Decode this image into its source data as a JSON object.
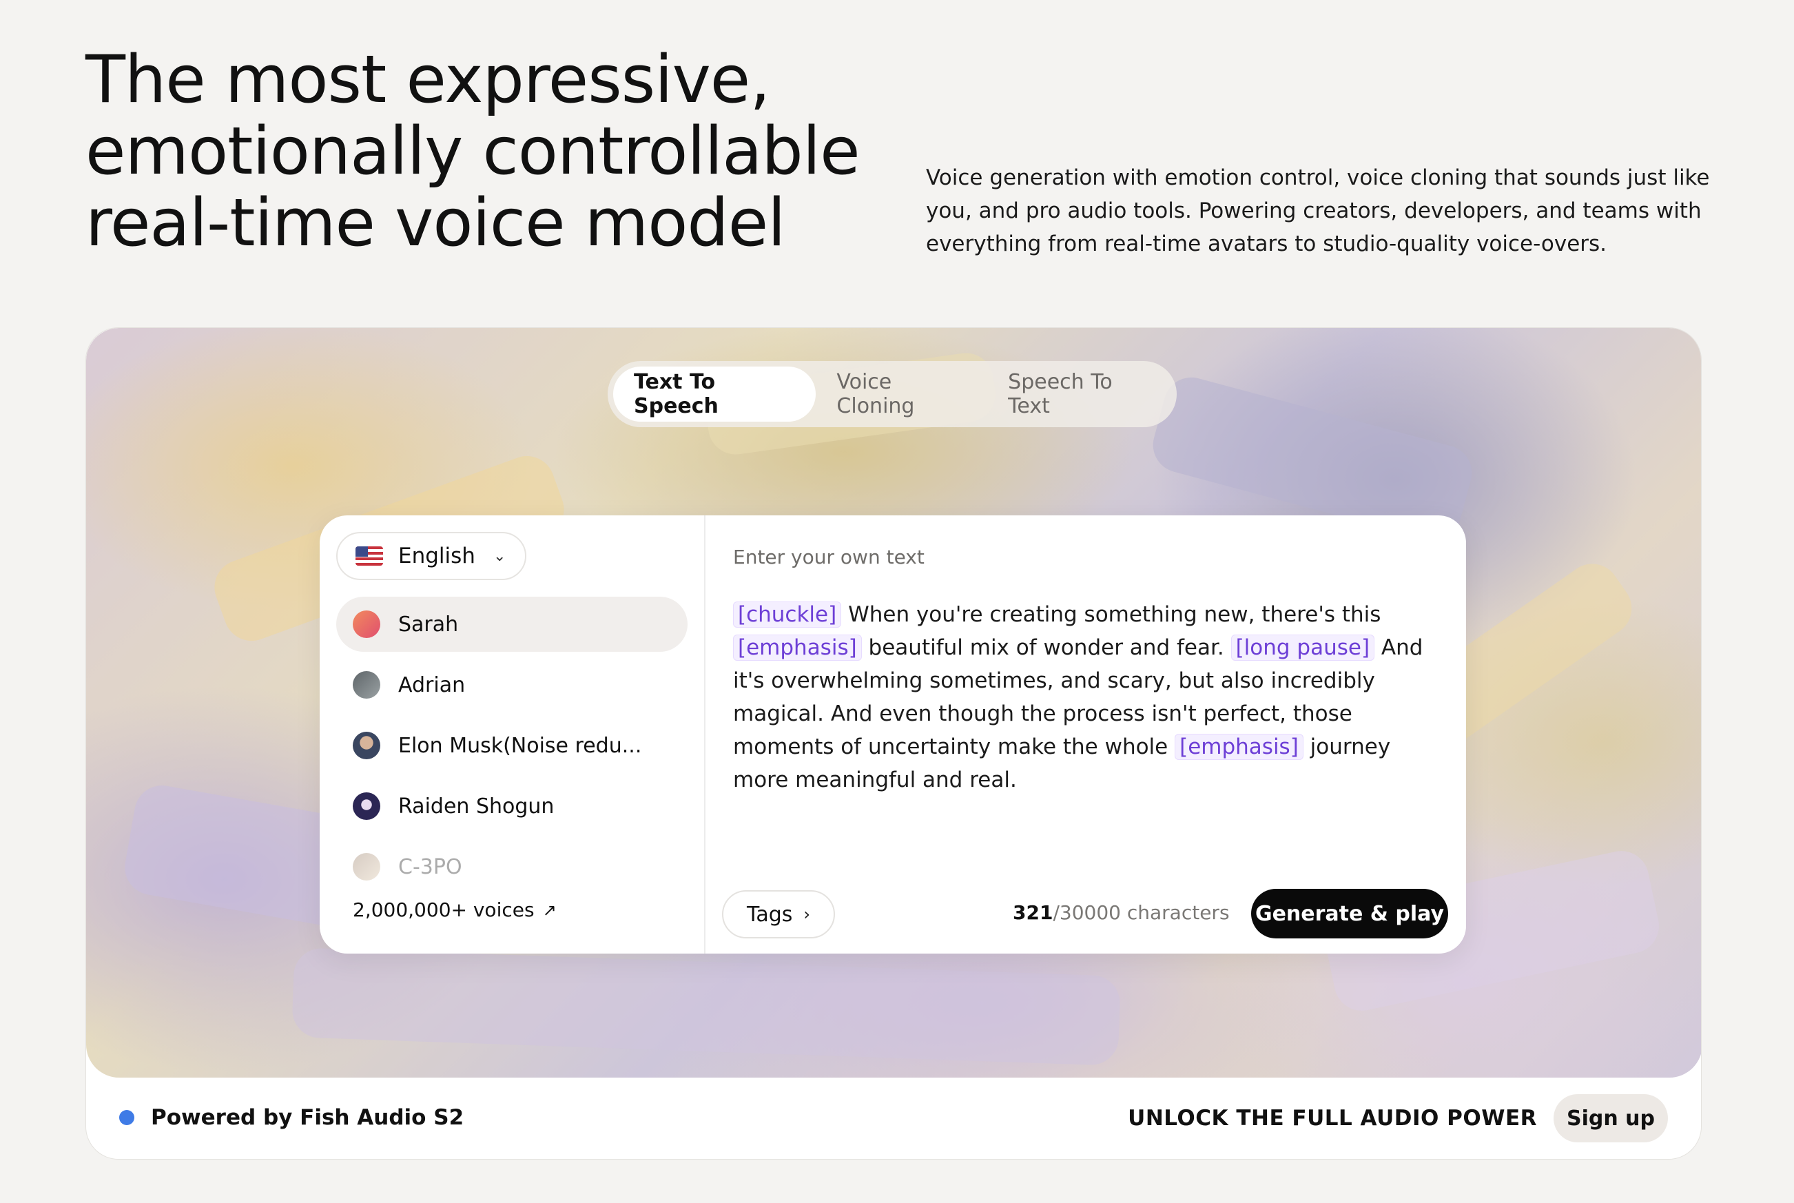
{
  "hero": {
    "title_line1": "The most expressive,",
    "title_line2": "emotionally controllable",
    "title_line3": "real-time voice model",
    "description": "Voice generation with emotion control, voice cloning that sounds just like you, and pro audio tools. Powering creators, developers, and teams with everything from real-time avatars to studio-quality voice-overs."
  },
  "tabs": [
    {
      "label": "Text To Speech",
      "active": true
    },
    {
      "label": "Voice Cloning",
      "active": false
    },
    {
      "label": "Speech To Text",
      "active": false
    }
  ],
  "language": {
    "selected": "English",
    "icon": "us-flag-icon"
  },
  "voices": [
    {
      "name": "Sarah",
      "selected": true,
      "color": "#e8685a"
    },
    {
      "name": "Adrian",
      "selected": false,
      "color": "#6b7278"
    },
    {
      "name": "Elon Musk(Noise redu...",
      "selected": false,
      "color": "#5a6a8a"
    },
    {
      "name": "Raiden Shogun",
      "selected": false,
      "color": "#3e3a6a"
    },
    {
      "name": "C-3PO",
      "selected": false,
      "color": "#b89a80"
    }
  ],
  "voices_count": "2,000,000+ voices",
  "editor": {
    "placeholder": "Enter your own text",
    "segments": [
      {
        "type": "tag",
        "text": "[chuckle]"
      },
      {
        "type": "text",
        "text": " When you're creating something new, there's this "
      },
      {
        "type": "tag",
        "text": "[emphasis]"
      },
      {
        "type": "text",
        "text": " beautiful mix of wonder and fear. "
      },
      {
        "type": "tag",
        "text": "[long pause]"
      },
      {
        "type": "text",
        "text": " And it's overwhelming sometimes, and scary, but also incredibly magical. And even though the process isn't perfect, those moments of uncertainty make the whole "
      },
      {
        "type": "tag",
        "text": "[emphasis]"
      },
      {
        "type": "text",
        "text": " journey more meaningful and real."
      }
    ]
  },
  "tags_button": "Tags",
  "char_count": "321",
  "char_limit": "/30000 characters",
  "generate_button": "Generate & play",
  "footer": {
    "powered_by": "Powered by Fish Audio S2",
    "unlock": "UNLOCK THE FULL AUDIO POWER",
    "signup": "Sign up"
  }
}
